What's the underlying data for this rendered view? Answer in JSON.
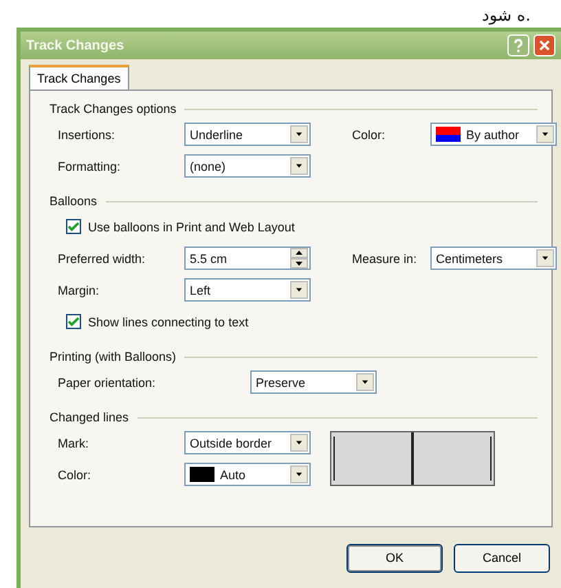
{
  "caption_fragment": "ه شود.",
  "window": {
    "title": "Track Changes"
  },
  "tabs": [
    {
      "label": "Track Changes",
      "selected": true
    }
  ],
  "groups": [
    {
      "title": "Track Changes options",
      "rows": [
        [
          {
            "kind": "dropdown",
            "label": "Insertions:",
            "value": "Underline"
          },
          {
            "kind": "dropdown",
            "label": "Color:",
            "value": "By author",
            "swatch": [
              {
                "color": "#ff0000"
              },
              {
                "color": "#0000ff"
              }
            ]
          }
        ],
        [
          {
            "kind": "dropdown",
            "label": "Formatting:",
            "value": "(none)"
          }
        ]
      ]
    },
    {
      "title": "Balloons",
      "rows": [
        [
          {
            "kind": "checkbox",
            "label": "Use balloons in Print and Web Layout",
            "checked": true
          }
        ],
        [
          {
            "kind": "spin",
            "label": "Preferred width:",
            "value": "5.5 cm"
          },
          {
            "kind": "dropdown",
            "label": "Measure in:",
            "value": "Centimeters"
          }
        ],
        [
          {
            "kind": "dropdown",
            "label": "Margin:",
            "value": "Left"
          }
        ],
        [
          {
            "kind": "checkbox",
            "label": "Show lines connecting to text",
            "checked": true
          }
        ]
      ]
    },
    {
      "title": "Printing (with Balloons)",
      "rows": [
        [
          {
            "kind": "dropdown",
            "label": "Paper orientation:",
            "value": "Preserve",
            "wide_label": true
          }
        ]
      ]
    },
    {
      "title": "Changed lines",
      "preview": true,
      "rows": [
        [
          {
            "kind": "dropdown",
            "label": "Mark:",
            "value": "Outside border"
          }
        ],
        [
          {
            "kind": "dropdown",
            "label": "Color:",
            "value": "Auto",
            "swatch": [
              {
                "color": "#000000"
              }
            ]
          }
        ]
      ]
    }
  ],
  "buttons": [
    {
      "label": "OK",
      "default": true
    },
    {
      "label": "Cancel",
      "default": false
    }
  ]
}
